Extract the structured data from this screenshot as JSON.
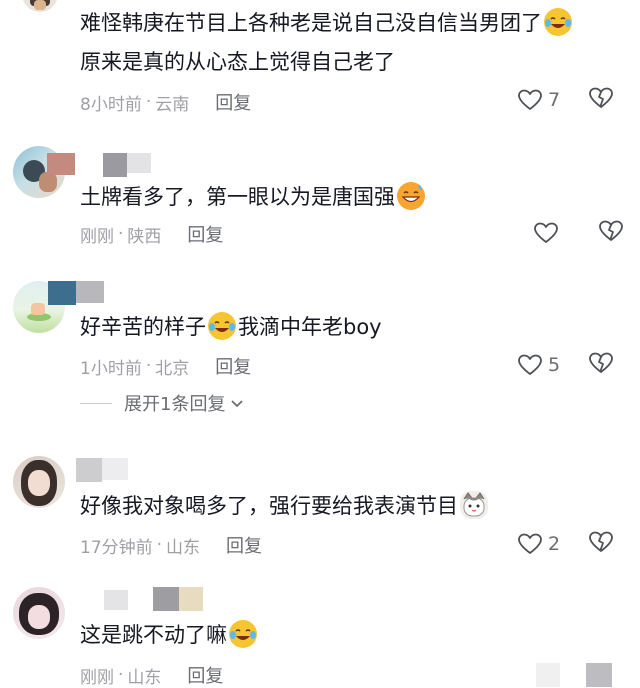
{
  "comments": [
    {
      "text_line1": "难怪韩庚在节目上各种老是说自己没自信当男团了",
      "text_line2": "原来是真的从心态上觉得自己老了",
      "time": "8小时前",
      "location": "云南",
      "reply_label": "回复",
      "likes": "7"
    },
    {
      "text": "土牌看多了，第一眼以为是唐国强",
      "time": "刚刚",
      "location": "陕西",
      "reply_label": "回复",
      "likes": ""
    },
    {
      "text_a": "好辛苦的样子",
      "text_b": "我滴中年老boy",
      "time": "1小时前",
      "location": "北京",
      "reply_label": "回复",
      "likes": "5",
      "expand_label": "展开1条回复"
    },
    {
      "text": "好像我对象喝多了，强行要给我表演节目",
      "time": "17分钟前",
      "location": "山东",
      "reply_label": "回复",
      "likes": "2"
    },
    {
      "text": "这是跳不动了嘛",
      "time": "刚刚",
      "location": "山东",
      "reply_label": "回复",
      "likes": ""
    }
  ],
  "separator": "·",
  "icons": {
    "like": "heart-outline-icon",
    "dislike": "broken-heart-icon",
    "expand": "chevron-down-icon",
    "crying_laugh": "crying-laughing-emoji-icon",
    "sweat_smile": "sweat-smile-emoji-icon",
    "cat": "cat-emoji-icon"
  },
  "colors": {
    "text": "#161823",
    "meta": "#9fa0a6",
    "reply": "#6b6d74",
    "emoji_yellow": "#f7c531"
  }
}
